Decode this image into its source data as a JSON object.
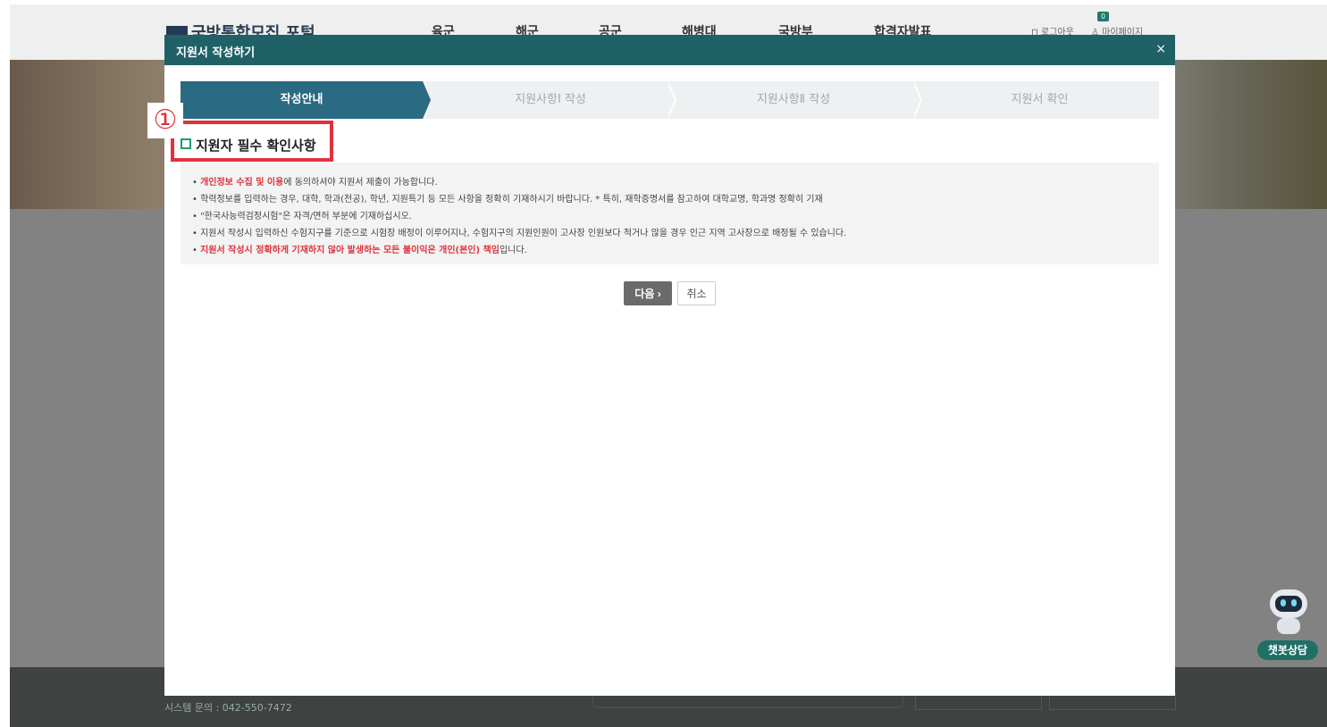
{
  "site": {
    "logo": "국방통합모집 포털",
    "nav": [
      "육군",
      "해군",
      "공군",
      "해병대",
      "국방부",
      "합격자발표"
    ],
    "util": {
      "logout": "로그아웃",
      "mypage": "마이페이지",
      "badge": "0"
    }
  },
  "footer": {
    "system_contact": "시스템 문의 : 042-550-7472"
  },
  "chatbot": {
    "label": "챗봇상담"
  },
  "modal": {
    "title": "지원서 작성하기",
    "close": "×",
    "steps": [
      "작성안내",
      "지원사항Ⅰ 작성",
      "지원사항Ⅱ 작성",
      "지원서 확인"
    ],
    "active_step": 0,
    "annotation_number": "①",
    "section_title": "지원자 필수 확인사항",
    "notices": [
      {
        "bullet": "• ",
        "red": "개인정보 수집 및 이용",
        "text": "에 동의하셔야 지원서 제출이 가능합니다."
      },
      {
        "bullet": "• ",
        "red": "",
        "text": "학력정보를 입력하는 경우, 대학, 학과(전공), 학년, 지원특기 등 모든 사항을 정확히 기재하시기 바랍니다. * 특히, 재학증명서를 참고하여 대학교명, 학과명 정확히 기재"
      },
      {
        "bullet": "• ",
        "red": "",
        "text": "\"한국사능력검정시험\"은 자격/면허 부분에 기재하십시오."
      },
      {
        "bullet": "• ",
        "red": "",
        "text": "지원서 작성시 입력하신 수험지구를 기준으로 시험장 배정이 이루어지나, 수험지구의 지원인원이 고사장 인원보다 적거나 많을 경우 인근 지역 고사장으로 배정될 수 있습니다."
      },
      {
        "bullet": "• ",
        "red": "지원서 작성시 정확하게 기재하지 않아 발생하는 모든 불이익은 개인(본인) 책임",
        "text": "입니다."
      }
    ],
    "next_label": "다음 ›",
    "cancel_label": "취소"
  }
}
